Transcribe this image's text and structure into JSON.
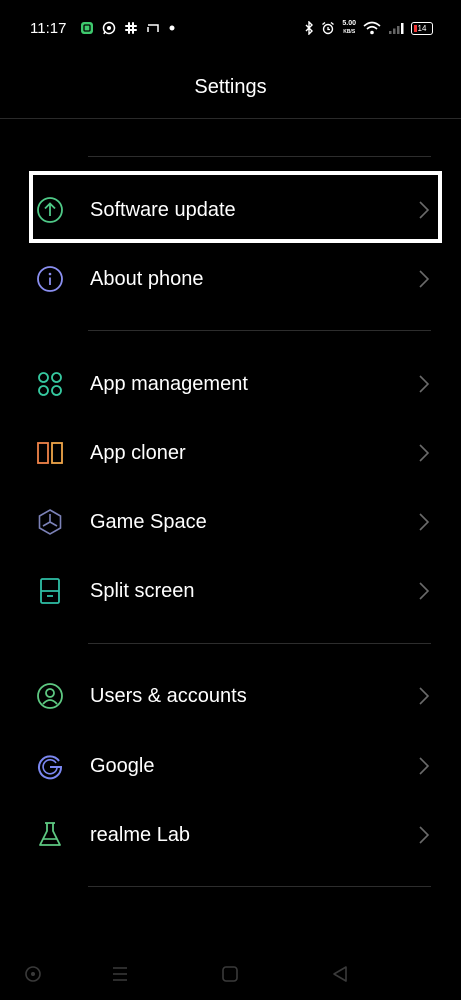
{
  "status_bar": {
    "time": "11:17",
    "speed_value": "5.00",
    "speed_unit": "KB/S",
    "battery": "14",
    "notification_icons": [
      "app-icon",
      "whatsapp-icon",
      "slack-icon",
      "cast-icon",
      "dot-icon"
    ],
    "system_icons": [
      "bluetooth-icon",
      "alarm-icon",
      "wifi-icon",
      "signal-icon",
      "battery-icon"
    ]
  },
  "header": {
    "title": "Settings"
  },
  "settings_items": [
    {
      "label": "Software update",
      "icon": "arrow-up-circle-icon",
      "color": "#4fc987"
    },
    {
      "label": "About phone",
      "icon": "info-circle-icon",
      "color": "#8a8ff0"
    },
    {
      "label": "App management",
      "icon": "apps-grid-icon",
      "color": "#36c9a0"
    },
    {
      "label": "App cloner",
      "icon": "clone-icon",
      "color": "#f0844a"
    },
    {
      "label": "Game Space",
      "icon": "game-space-icon",
      "color": "#7c82b8"
    },
    {
      "label": "Split screen",
      "icon": "split-screen-icon",
      "color": "#2fc0a6"
    },
    {
      "label": "Users & accounts",
      "icon": "user-circle-icon",
      "color": "#5ec982"
    },
    {
      "label": "Google",
      "icon": "google-icon",
      "color": "#7b87f0"
    },
    {
      "label": "realme Lab",
      "icon": "flask-icon",
      "color": "#5ec982"
    }
  ],
  "nav_bar": {
    "buttons": [
      "assistant-button",
      "menu-button",
      "home-button",
      "back-button"
    ],
    "color": "#3a3a3a"
  }
}
